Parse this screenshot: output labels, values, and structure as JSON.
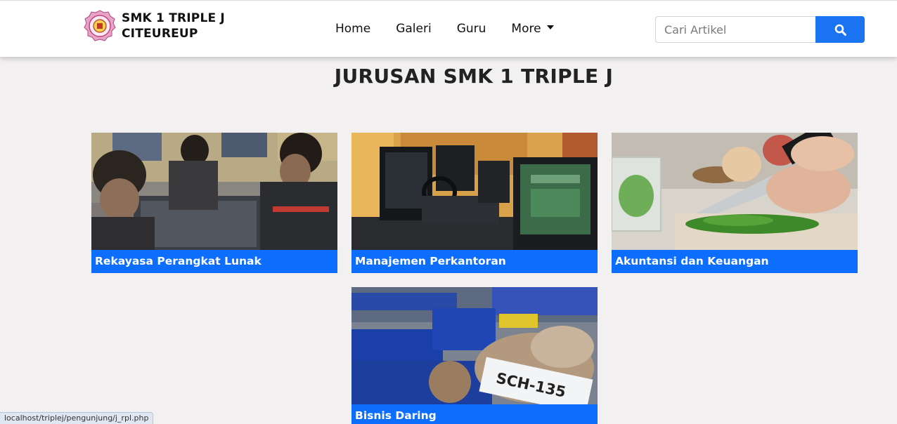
{
  "brand": {
    "line1": "SMK 1 TRIPLE J",
    "line2": "CITEUREUP"
  },
  "nav": {
    "home": "Home",
    "galeri": "Galeri",
    "guru": "Guru",
    "more": "More"
  },
  "search": {
    "placeholder": "Cari Artikel"
  },
  "page": {
    "title": "JURUSAN SMK 1 TRIPLE J"
  },
  "cards": [
    {
      "caption": "Rekayasa Perangkat Lunak"
    },
    {
      "caption": "Manajemen Perkantoran"
    },
    {
      "caption": "Akuntansi dan Keuangan"
    },
    {
      "caption": "Bisnis Daring"
    }
  ],
  "status": {
    "url": "localhost/triplej/pengunjung/j_rpl.php"
  },
  "colors": {
    "accent": "#0d6efd",
    "background": "#f2f0f1"
  }
}
